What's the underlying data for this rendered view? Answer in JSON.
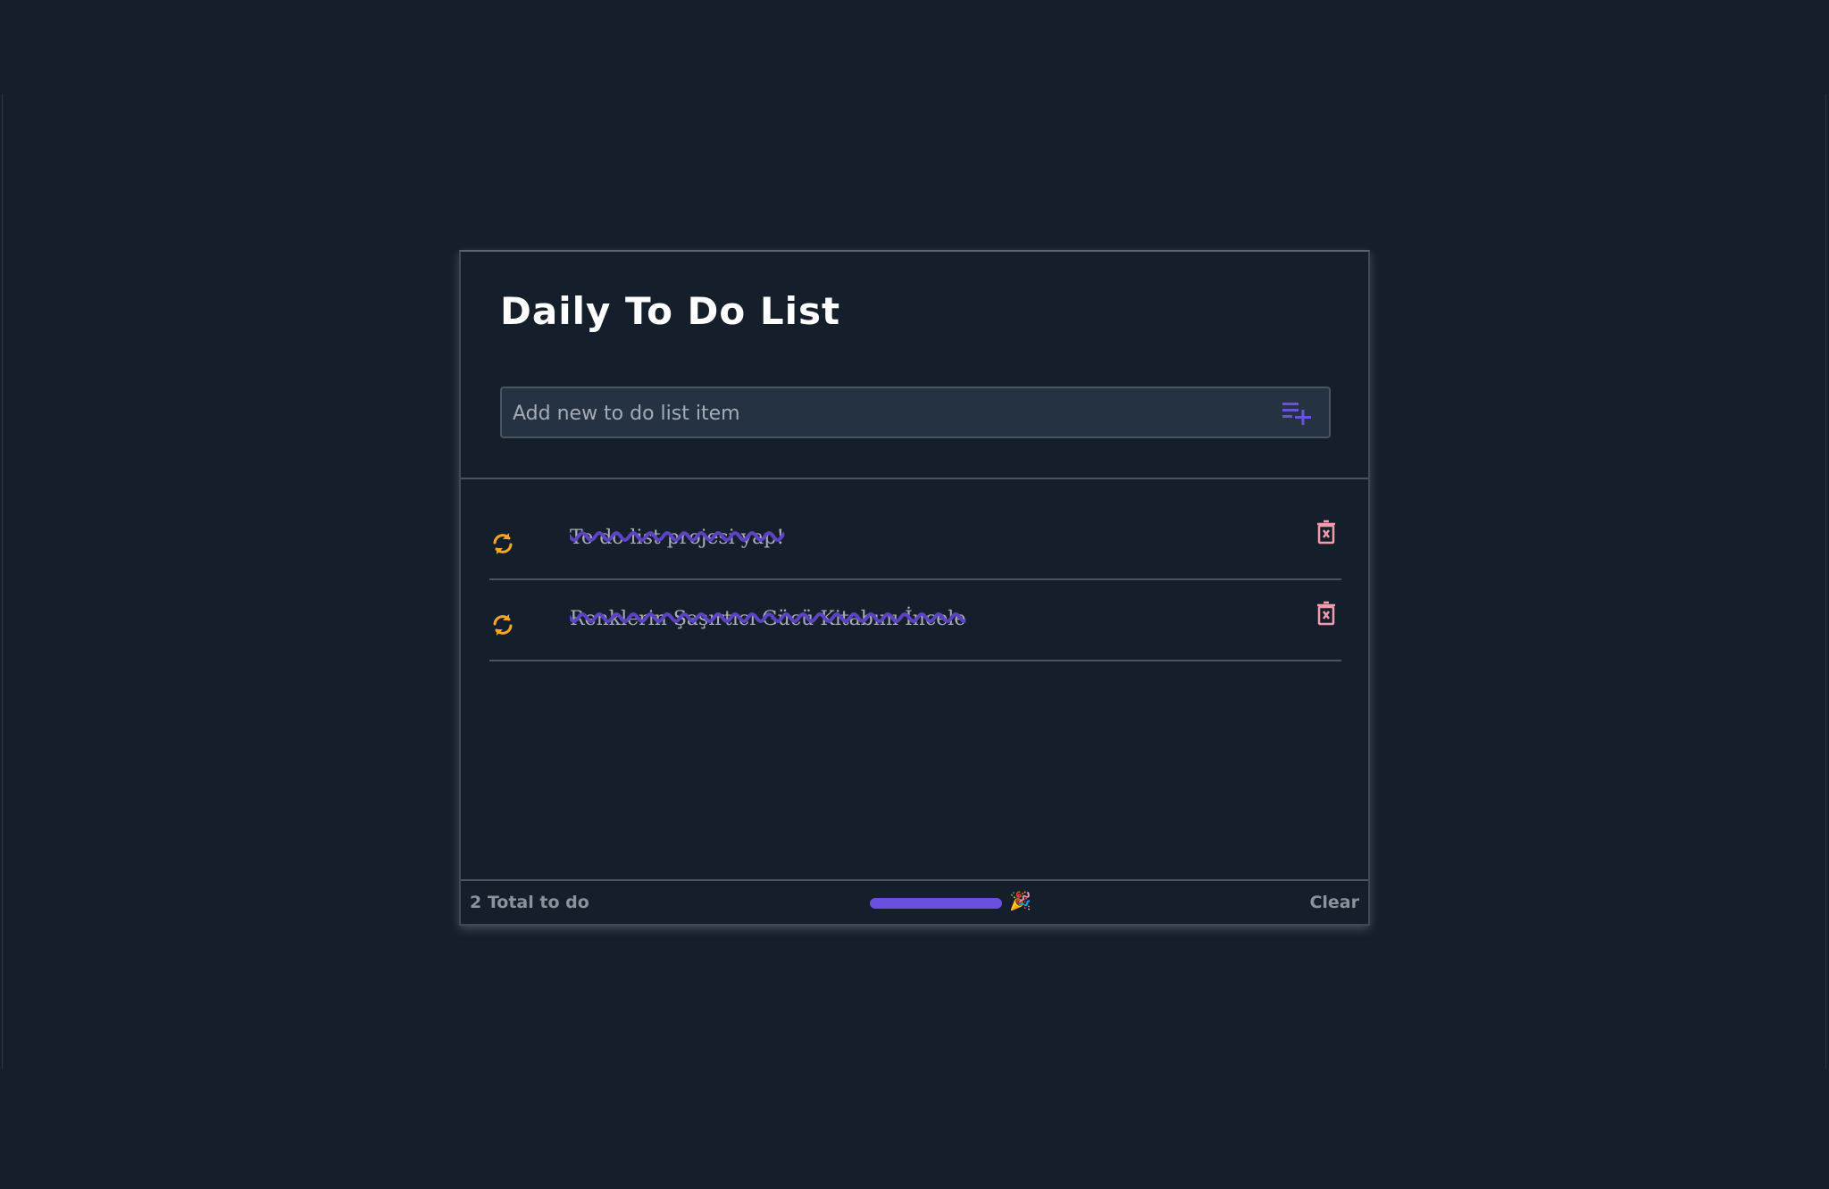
{
  "title": "Daily To Do List",
  "input": {
    "placeholder": "Add new to do list item",
    "value": "",
    "add_icon": "playlist-add-icon"
  },
  "items": [
    {
      "text": "To do list projesi yap!",
      "completed": true,
      "toggle_icon": "refresh-icon",
      "delete_icon": "trash-x-icon"
    },
    {
      "text": "Renklerin Şaşırtıcı Gücü Kitabını İncele",
      "completed": true,
      "toggle_icon": "refresh-icon",
      "delete_icon": "trash-x-icon"
    }
  ],
  "footer": {
    "count_label": "2 Total to do",
    "progress_percent": 100,
    "celebration_emoji": "🎉",
    "clear_label": "Clear"
  },
  "colors": {
    "accent": "#6b4fe0",
    "toggle": "#f5a623",
    "delete": "#f29bab",
    "background": "#151f2c"
  }
}
